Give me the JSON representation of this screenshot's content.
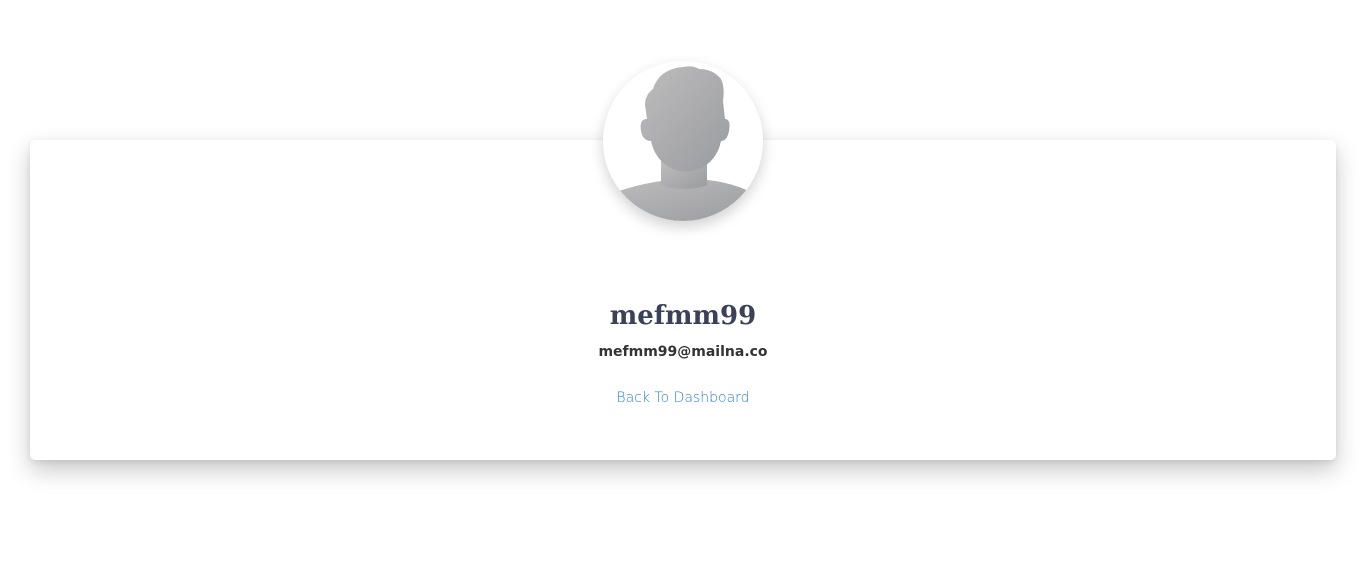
{
  "profile": {
    "avatar_icon": "default-user-silhouette-icon",
    "username": "mefmm99",
    "email": "mefmm99@mailna.co",
    "back_link_label": "Back To Dashboard"
  },
  "colors": {
    "link": "#2f80d8",
    "username": "#3b4157",
    "email": "#333333"
  }
}
